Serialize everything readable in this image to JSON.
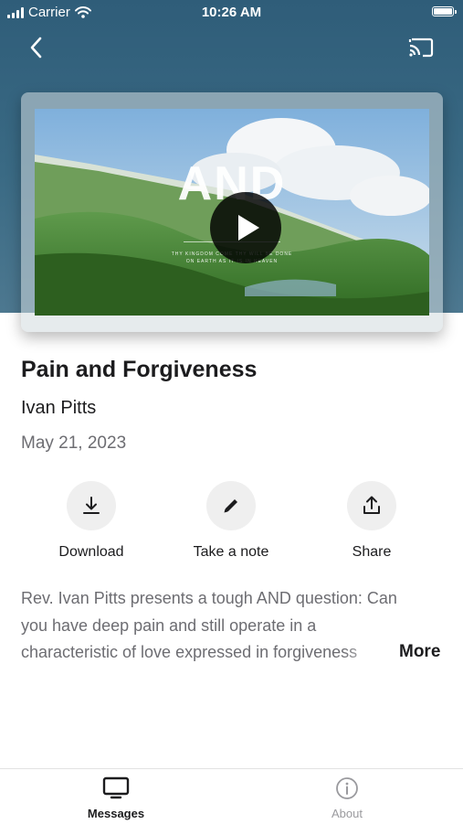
{
  "status_bar": {
    "carrier": "Carrier",
    "time": "10:26 AM"
  },
  "header": {
    "back_icon": "chevron-left-icon",
    "cast_icon": "cast-icon",
    "background_color": "#3a6a84"
  },
  "video": {
    "overlay_title": "AND",
    "overlay_subtitle_line1": "THY KINGDOM COME THY WILL BE DONE",
    "overlay_subtitle_line2": "ON EARTH AS IT IS IN HEAVEN",
    "play_icon": "play-icon"
  },
  "message": {
    "title": "Pain and Forgiveness",
    "speaker": "Ivan Pitts",
    "date": "May 21, 2023"
  },
  "actions": [
    {
      "label": "Download",
      "icon": "download-icon"
    },
    {
      "label": "Take a note",
      "icon": "pencil-icon"
    },
    {
      "label": "Share",
      "icon": "share-icon"
    }
  ],
  "description": {
    "line1": "Rev. Ivan Pitts presents a tough AND question: Can",
    "line2": "you have deep pain and still operate in a",
    "line3": "characteristic of love expressed in forgiveness",
    "more_label": "More"
  },
  "tab_bar": {
    "tabs": [
      {
        "label": "Messages",
        "icon": "tv-icon",
        "active": true
      },
      {
        "label": "About",
        "icon": "info-icon",
        "active": false
      }
    ],
    "active_color": "#1c1c1e",
    "inactive_color": "#9a9a9e"
  }
}
